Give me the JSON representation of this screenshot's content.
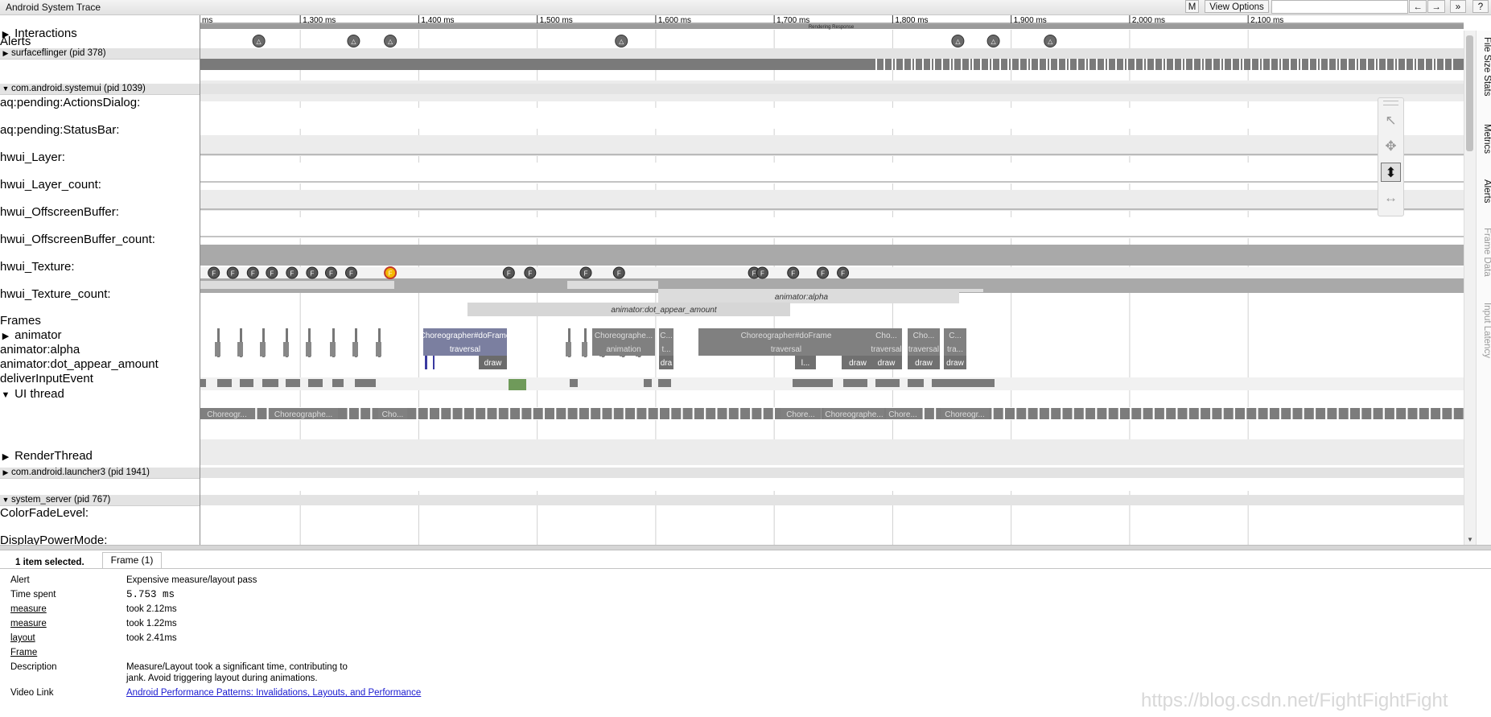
{
  "app_title": "Android System Trace",
  "toolbar": {
    "m_label": "M",
    "view_options_label": "View Options",
    "nav_back": "←",
    "nav_forward": "→",
    "nav_more": "»",
    "help": "?"
  },
  "ruler": {
    "ticks": [
      {
        "label": "ms",
        "t": 1215
      },
      {
        "label": "1,300 ms",
        "t": 1300
      },
      {
        "label": "1,400 ms",
        "t": 1400
      },
      {
        "label": "1,500 ms",
        "t": 1500
      },
      {
        "label": "1,600 ms",
        "t": 1600
      },
      {
        "label": "1,700 ms",
        "t": 1700
      },
      {
        "label": "1,800 ms",
        "t": 1800
      },
      {
        "label": "1,900 ms",
        "t": 1900
      },
      {
        "label": "2,000 ms",
        "t": 2000
      },
      {
        "label": "2,100 ms",
        "t": 2100
      }
    ],
    "rendering_response_label": "Rendering Response"
  },
  "tracks": {
    "interactions": "Interactions",
    "alerts": "Alerts",
    "surfaceflinger": "surfaceflinger (pid 378)",
    "systemui": "com.android.systemui (pid 1039)",
    "counters": [
      "aq:pending:ActionsDialog:",
      "aq:pending:StatusBar:",
      "hwui_Layer:",
      "hwui_Layer_count:",
      "hwui_OffscreenBuffer:",
      "hwui_OffscreenBuffer_count:",
      "hwui_Texture:",
      "hwui_Texture_count:"
    ],
    "frames": "Frames",
    "animator": "animator",
    "animator_alpha": "animator:alpha",
    "animator_dot": "animator:dot_appear_amount",
    "deliver_input": "deliverInputEvent",
    "ui_thread": "UI thread",
    "render_thread": "RenderThread",
    "launcher": "com.android.launcher3 (pid 1941)",
    "system_server": "system_server (pid 767)",
    "color_fade": "ColorFadeLevel:",
    "display_power": "DisplayPowerMode:"
  },
  "alert_markers": [
    1265,
    1345,
    1376,
    1571,
    1855,
    1885,
    1933
  ],
  "frame_markers": [
    {
      "t": 1227,
      "selected": false
    },
    {
      "t": 1243,
      "selected": false
    },
    {
      "t": 1260,
      "selected": false
    },
    {
      "t": 1276,
      "selected": false
    },
    {
      "t": 1293,
      "selected": false
    },
    {
      "t": 1310,
      "selected": false
    },
    {
      "t": 1326,
      "selected": false
    },
    {
      "t": 1343,
      "selected": false
    },
    {
      "t": 1376,
      "selected": true
    },
    {
      "t": 1476,
      "selected": false
    },
    {
      "t": 1494,
      "selected": false
    },
    {
      "t": 1541,
      "selected": false
    },
    {
      "t": 1569,
      "selected": false
    },
    {
      "t": 1683,
      "selected": false
    },
    {
      "t": 1690,
      "selected": false
    },
    {
      "t": 1716,
      "selected": false
    },
    {
      "t": 1741,
      "selected": false
    },
    {
      "t": 1758,
      "selected": false
    }
  ],
  "animator_labels": {
    "alpha_slice": "animator:alpha",
    "dot_slice": "animator:dot_appear_amount"
  },
  "ui_slices": [
    {
      "label": "Choreographer#doFrame",
      "label2": "traversal",
      "label3": "draw"
    },
    {
      "label": "Choreographe...",
      "label2": "animation"
    },
    {
      "label": "C...",
      "label2": "t...",
      "label3": "dra"
    },
    {
      "label": "Choreographer#doFrame",
      "label2": "traversal",
      "label3": "draw",
      "label4": "l..."
    },
    {
      "label": "Cho...",
      "label2": "traversal",
      "label3": "draw"
    },
    {
      "label": "Cho...",
      "label2": "traversal",
      "label3": "draw"
    },
    {
      "label": "C...",
      "label2": "tra...",
      "label3": "draw"
    }
  ],
  "launcher_slices": [
    "Choreogr...",
    "Choreographe...",
    "Cho...",
    "Chore...",
    "Choreographe...",
    "Chore...",
    "Choreogr..."
  ],
  "side_tabs": [
    "File Size Stats",
    "Metrics",
    "Alerts",
    "Frame Data",
    "Input Latency"
  ],
  "mouse_tools": {
    "select": "select-tool",
    "pan": "pan-tool",
    "zoom": "zoom-tool",
    "timing": "timing-tool"
  },
  "analysis": {
    "selection_summary": "1 item selected.",
    "tab_label": "Frame (1)",
    "rows": [
      {
        "label": "Alert",
        "value": "Expensive measure/layout pass"
      },
      {
        "label": "Time spent",
        "value": "5.753 ms"
      },
      {
        "label": "measure",
        "value": "took 2.12ms"
      },
      {
        "label": "measure",
        "value": "took 1.22ms"
      },
      {
        "label": "layout",
        "value": "took 2.41ms"
      },
      {
        "label": "Frame",
        "value": ""
      },
      {
        "label": "Description",
        "value": "Measure/Layout took a significant time, contributing to",
        "value2": "jank. Avoid triggering layout during animations."
      },
      {
        "label": "Video Link",
        "value": "Android Performance Patterns: Invalidations, Layouts, and Performance"
      }
    ]
  },
  "watermark": "https://blog.csdn.net/FightFightFight",
  "colors": {
    "selected_frame": "#f5b800",
    "ui_selected_slice": "#7b7fa0",
    "ui_slice": "#808080",
    "render_green": "#6f9a5a"
  }
}
